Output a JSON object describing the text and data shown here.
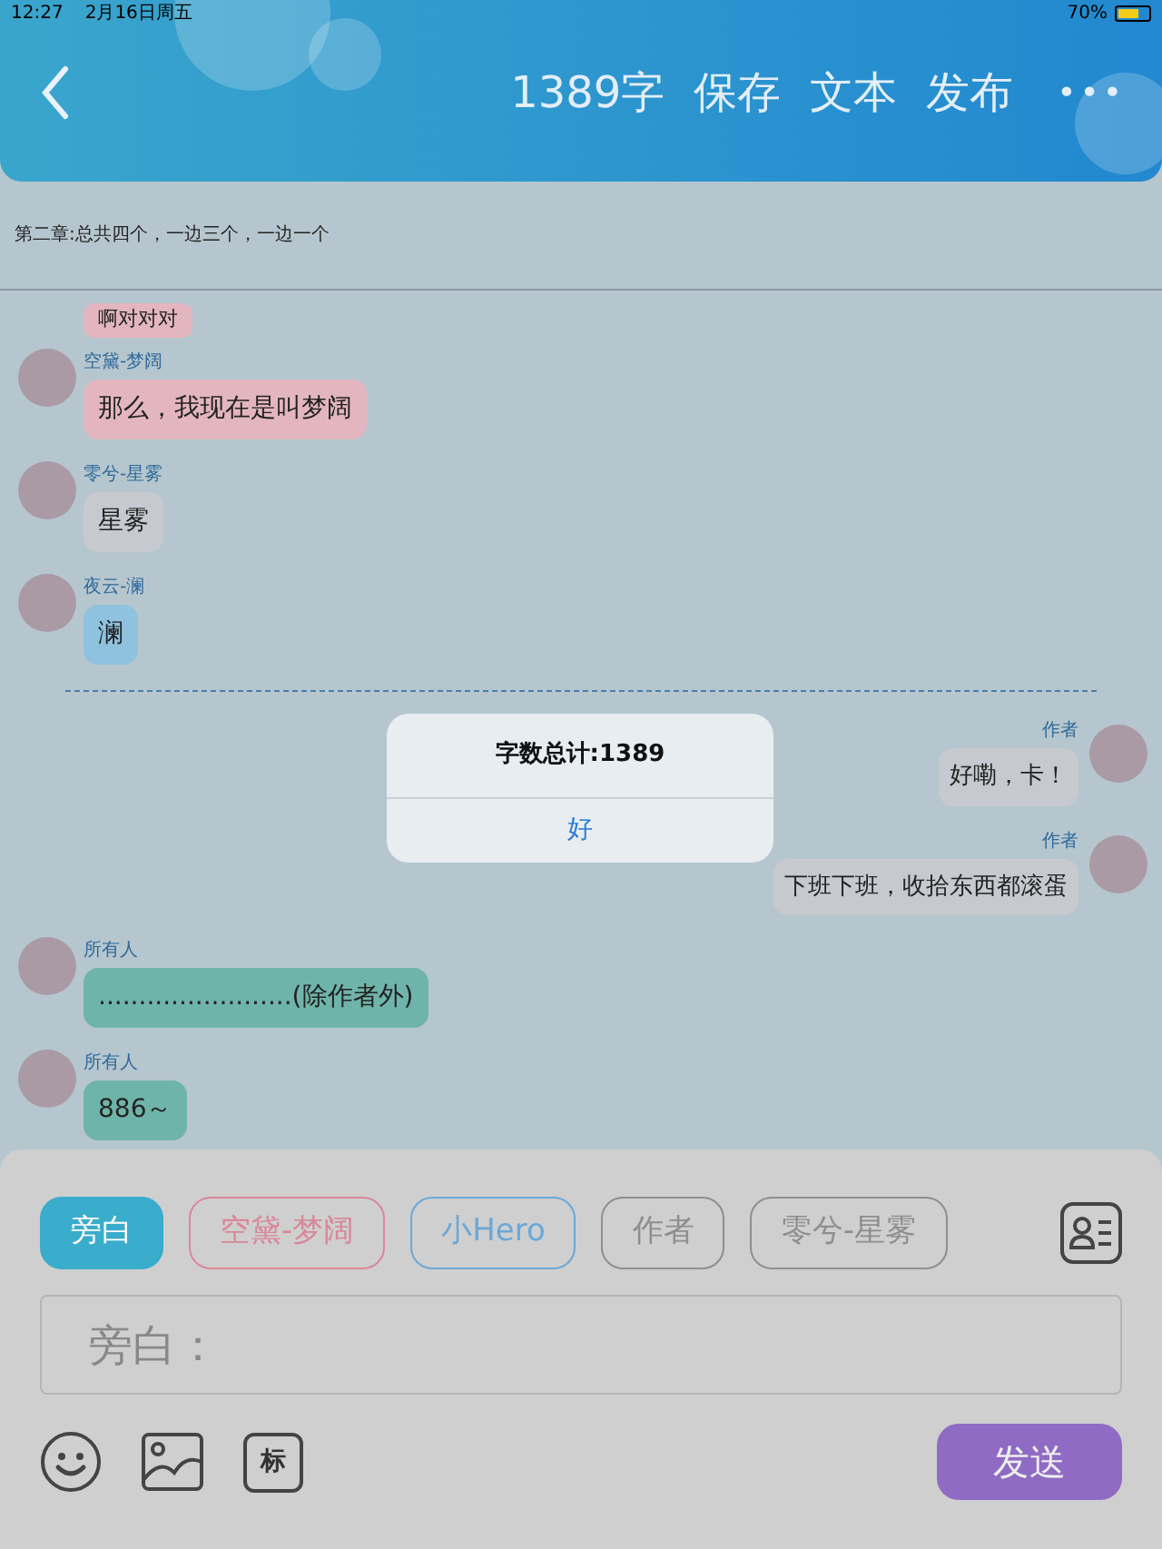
{
  "status_bar": {
    "time": "12:27",
    "date": "2月16日周五",
    "battery": "70%"
  },
  "header": {
    "word_count": "1389字",
    "actions": [
      "保存",
      "文本",
      "发布"
    ],
    "more": "•••"
  },
  "chapter_title": "第二章:总共四个，一边三个，一边一个",
  "messages": [
    {
      "kind": "left",
      "text": "啊对对对",
      "color": "#e3b6bf"
    },
    {
      "kind": "left",
      "name": "空黛-梦阔",
      "text": "那么，我现在是叫梦阔",
      "color": "#e3b6bf"
    },
    {
      "kind": "left",
      "name": "零兮-星雾",
      "text": "星雾",
      "color": "#c6c9cf"
    },
    {
      "kind": "left",
      "name": "夜云-澜",
      "text": "澜",
      "color": "#8fc2df"
    },
    {
      "kind": "divider"
    },
    {
      "kind": "right",
      "name": "作者",
      "text": "好嘞，卡！",
      "color": "#c6c9cf"
    },
    {
      "kind": "right",
      "name": "作者",
      "text": "下班下班，收拾东西都滚蛋",
      "color": "#c6c9cf"
    },
    {
      "kind": "left",
      "name": "所有人",
      "text": "........................(除作者外)",
      "color": "#6fb4aa"
    },
    {
      "kind": "left",
      "name": "所有人",
      "text": "886～",
      "color": "#6fb4aa"
    }
  ],
  "alert": {
    "title": "字数总计:1389",
    "button": "好"
  },
  "roles": [
    {
      "label": "旁白",
      "selected": true,
      "color": "#3aaccc"
    },
    {
      "label": "空黛-梦阔",
      "selected": false,
      "color": "#d9879a"
    },
    {
      "label": "小Hero",
      "selected": false,
      "color": "#6aa8d8"
    },
    {
      "label": "作者",
      "selected": false,
      "color": "#8e8e8e"
    },
    {
      "label": "零兮-星雾",
      "selected": false,
      "color": "#8e8e8e"
    }
  ],
  "input": {
    "placeholder": "旁白："
  },
  "mark_button": "标",
  "send_button": "发送"
}
